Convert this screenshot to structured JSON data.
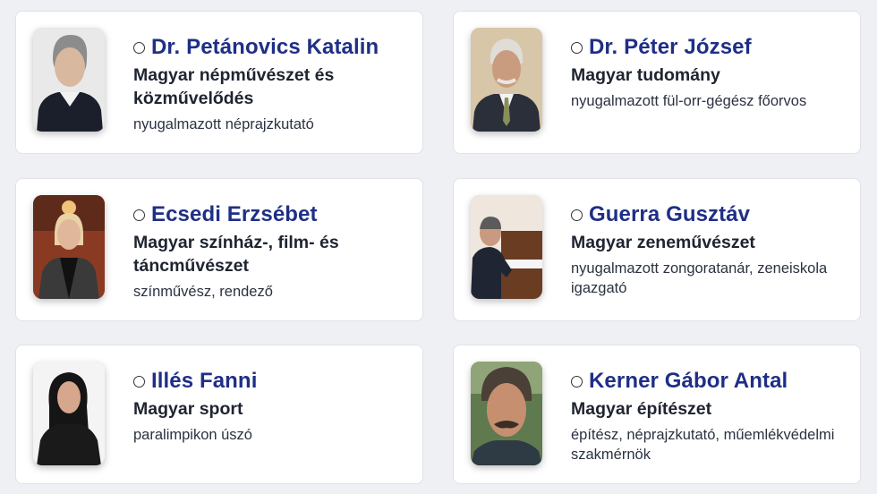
{
  "people": [
    {
      "name": "Dr. Petánovics Katalin",
      "category": "Magyar népművészet és közművelődés",
      "role": "nyugalmazott néprajzkutató",
      "photo_icon": "portrait-photo"
    },
    {
      "name": "Dr. Péter József",
      "category": "Magyar tudomány",
      "role": "nyugalmazott fül-orr-gégész főorvos",
      "photo_icon": "portrait-photo"
    },
    {
      "name": "Ecsedi Erzsébet",
      "category": "Magyar színház-, film- és táncművészet",
      "role": "színművész, rendező",
      "photo_icon": "portrait-photo"
    },
    {
      "name": "Guerra Gusztáv",
      "category": "Magyar zeneművészet",
      "role": "nyugalmazott zongoratanár, zeneiskola igazgató",
      "photo_icon": "portrait-photo"
    },
    {
      "name": "Illés Fanni",
      "category": "Magyar sport",
      "role": "paralimpikon úszó",
      "photo_icon": "portrait-photo"
    },
    {
      "name": "Kerner Gábor Antal",
      "category": "Magyar építészet",
      "role": "építész, néprajzkutató, műemlékvédelmi szakmérnök",
      "photo_icon": "portrait-photo"
    }
  ],
  "colors": {
    "name": "#1f2f86",
    "text": "#1e2430",
    "background": "#eef0f3",
    "card": "#ffffff"
  }
}
